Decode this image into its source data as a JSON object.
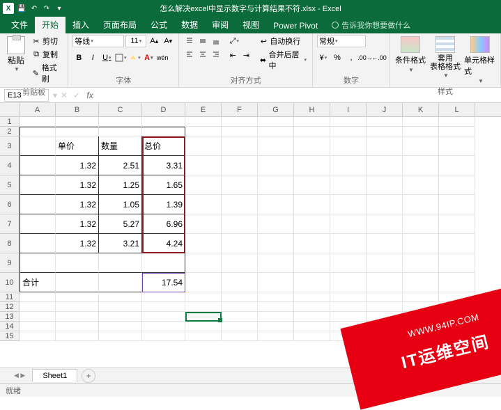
{
  "window": {
    "title": "怎么解决excel中显示数字与计算结果不符.xlsx - Excel"
  },
  "qat": {
    "save": "💾",
    "undo": "↶",
    "redo": "↷",
    "more": "▾"
  },
  "tabs": {
    "file": "文件",
    "home": "开始",
    "insert": "插入",
    "layout": "页面布局",
    "formulas": "公式",
    "data": "数据",
    "review": "审阅",
    "view": "视图",
    "powerpivot": "Power Pivot",
    "tellme": "告诉我你想要做什么"
  },
  "ribbon": {
    "clipboard": {
      "paste": "粘贴",
      "cut": "剪切",
      "copy": "复制",
      "painter": "格式刷",
      "label": "剪贴板"
    },
    "font": {
      "name": "等线",
      "size": "11",
      "label": "字体",
      "bold": "B",
      "italic": "I",
      "underline": "U"
    },
    "align": {
      "wrap": "自动换行",
      "merge": "合并后居中",
      "label": "对齐方式"
    },
    "number": {
      "format": "常规",
      "label": "数字"
    },
    "styles": {
      "cond": "条件格式",
      "table": "套用\n表格格式",
      "cell": "单元格样式",
      "label": "样式"
    }
  },
  "namebox": "E13",
  "fx": "fx",
  "columns": [
    "A",
    "B",
    "C",
    "D",
    "E",
    "F",
    "G",
    "H",
    "I",
    "J",
    "K",
    "L"
  ],
  "row_numbers": [
    "1",
    "2",
    "3",
    "4",
    "5",
    "6",
    "7",
    "8",
    "9",
    "10",
    "11",
    "12",
    "13",
    "14",
    "15"
  ],
  "table": {
    "h1": "单价",
    "h2": "数量",
    "h3": "总价",
    "r4": {
      "b": "1.32",
      "c": "2.51",
      "d": "3.31"
    },
    "r5": {
      "b": "1.32",
      "c": "1.25",
      "d": "1.65"
    },
    "r6": {
      "b": "1.32",
      "c": "1.05",
      "d": "1.39"
    },
    "r7": {
      "b": "1.32",
      "c": "5.27",
      "d": "6.96"
    },
    "r8": {
      "b": "1.32",
      "c": "3.21",
      "d": "4.24"
    },
    "total_label": "合计",
    "total": "17.54"
  },
  "sheet_tab": "Sheet1",
  "add_sheet": "+",
  "status": "就绪",
  "watermark": {
    "url": "WWW.94IP.COM",
    "title": "IT运维空间"
  },
  "chart_data": {
    "type": "table",
    "columns": [
      "单价",
      "数量",
      "总价"
    ],
    "rows": [
      [
        1.32,
        2.51,
        3.31
      ],
      [
        1.32,
        1.25,
        1.65
      ],
      [
        1.32,
        1.05,
        1.39
      ],
      [
        1.32,
        5.27,
        6.96
      ],
      [
        1.32,
        3.21,
        4.24
      ]
    ],
    "total_row": [
      "合计",
      null,
      17.54
    ]
  }
}
